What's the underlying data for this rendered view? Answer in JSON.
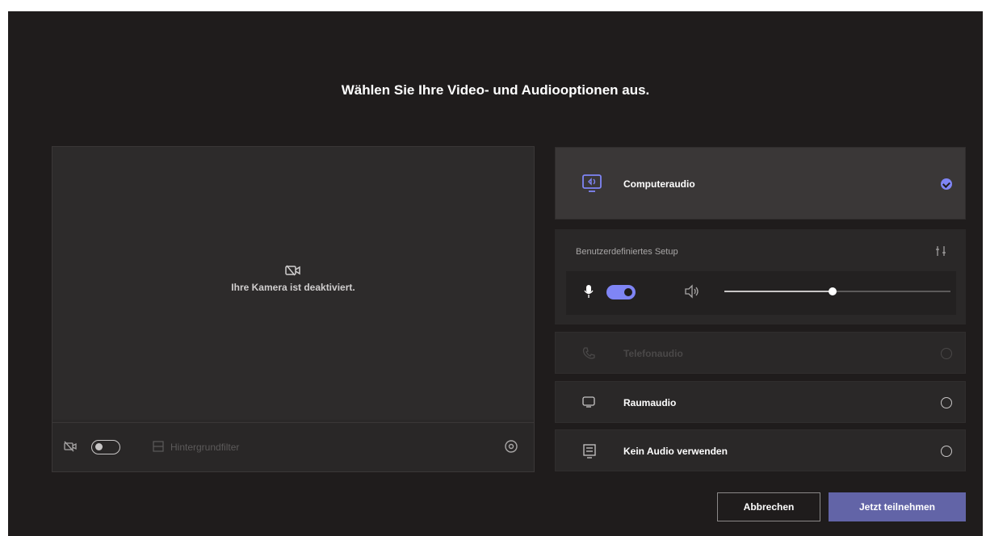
{
  "title": "Wählen Sie Ihre Video- und Audiooptionen aus.",
  "camera": {
    "off_text": "Ihre Kamera ist deaktiviert.",
    "toggle_on": false,
    "background_filter_label": "Hintergrundfilter"
  },
  "audio": {
    "options": [
      {
        "label": "Computeraudio",
        "icon": "computer-audio-icon",
        "selected": true,
        "disabled": false
      },
      {
        "label": "Telefonaudio",
        "icon": "phone-icon",
        "selected": false,
        "disabled": true
      },
      {
        "label": "Raumaudio",
        "icon": "room-audio-icon",
        "selected": false,
        "disabled": false
      },
      {
        "label": "Kein Audio verwenden",
        "icon": "no-audio-icon",
        "selected": false,
        "disabled": false
      }
    ],
    "custom_setup_label": "Benutzerdefiniertes Setup",
    "mic_on": true,
    "volume_level": 0.48
  },
  "buttons": {
    "cancel": "Abbrechen",
    "join": "Jetzt teilnehmen"
  },
  "colors": {
    "background": "#1f1c1c",
    "accent": "#7f85f5",
    "primary_button": "#6264a7"
  }
}
